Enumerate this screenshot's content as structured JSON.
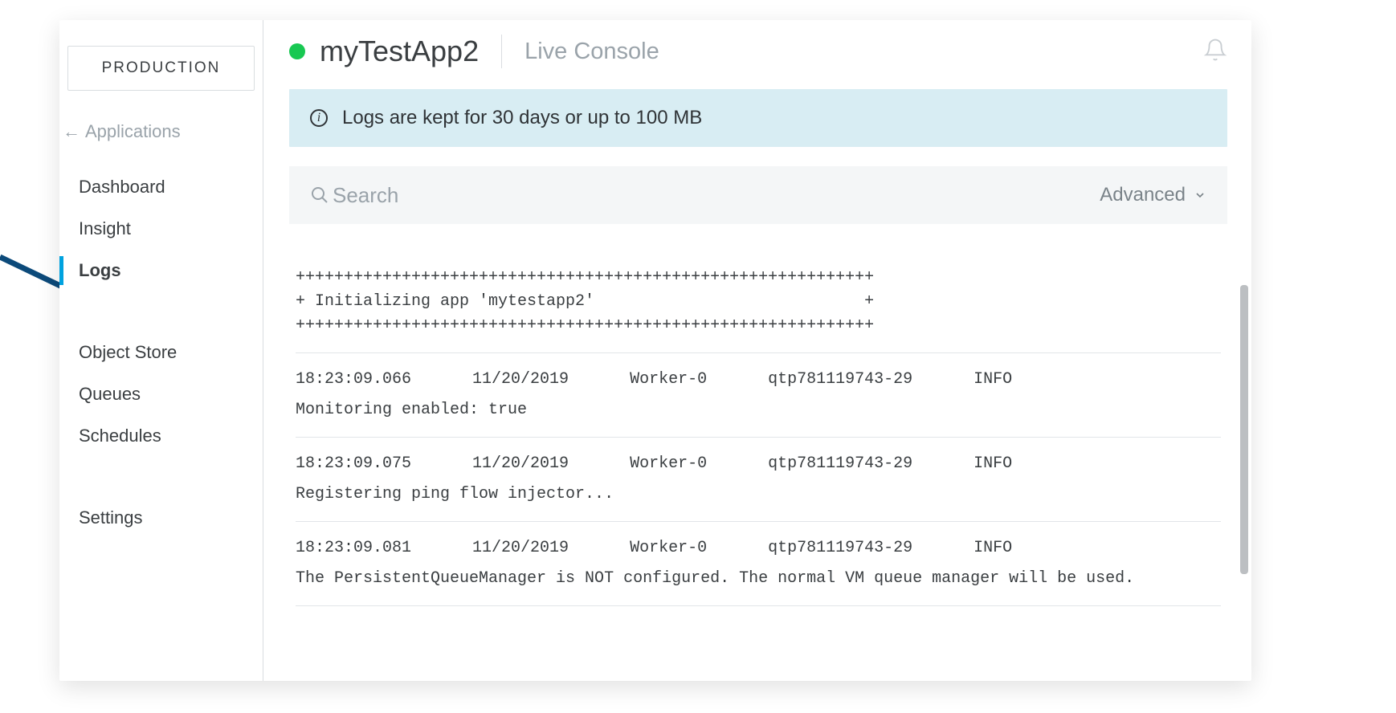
{
  "env_badge": "PRODUCTION",
  "back_link": {
    "arrow": "←",
    "label": "Applications"
  },
  "nav": {
    "items": [
      {
        "label": "Dashboard"
      },
      {
        "label": "Insight"
      },
      {
        "label": "Logs",
        "active": true
      },
      {
        "label": "Object Store"
      },
      {
        "label": "Queues"
      },
      {
        "label": "Schedules"
      },
      {
        "label": "Settings"
      }
    ]
  },
  "header": {
    "app_name": "myTestApp2",
    "section": "Live Console"
  },
  "info_banner": "Logs are kept for 30 days or up to 100 MB",
  "search": {
    "placeholder": "Search",
    "advanced_label": "Advanced"
  },
  "logs": {
    "preamble_border": "++++++++++++++++++++++++++++++++++++++++++++++++++++++++++++",
    "preamble_title": "+ Initializing app 'mytestapp2'                            +",
    "entries": [
      {
        "time": "18:23:09.066",
        "date": "11/20/2019",
        "worker": "Worker-0",
        "thread": "qtp781119743-29",
        "level": "INFO",
        "message": "Monitoring enabled: true"
      },
      {
        "time": "18:23:09.075",
        "date": "11/20/2019",
        "worker": "Worker-0",
        "thread": "qtp781119743-29",
        "level": "INFO",
        "message": "Registering ping flow injector..."
      },
      {
        "time": "18:23:09.081",
        "date": "11/20/2019",
        "worker": "Worker-0",
        "thread": "qtp781119743-29",
        "level": "INFO",
        "message": "The PersistentQueueManager is NOT configured. The normal VM queue manager will be used."
      }
    ]
  }
}
